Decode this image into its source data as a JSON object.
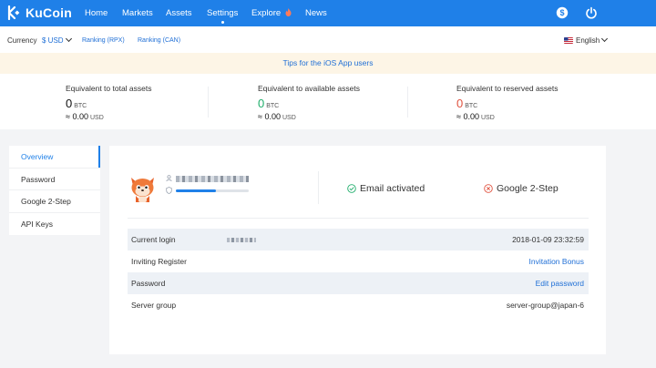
{
  "nav": {
    "brand": "KuCoin",
    "items": [
      {
        "label": "Home"
      },
      {
        "label": "Markets"
      },
      {
        "label": "Assets"
      },
      {
        "label": "Settings"
      },
      {
        "label": "Explore"
      },
      {
        "label": "News"
      }
    ],
    "active": "Settings",
    "icons": [
      "dollar-circle-icon",
      "power-icon"
    ]
  },
  "subbar": {
    "currency_label": "Currency",
    "currency_value": "$ USD",
    "ranking_rpx": "Ranking (RPX)",
    "ranking_can": "Ranking (CAN)",
    "language": "English"
  },
  "tips": {
    "text": "Tips for the iOS App users"
  },
  "assets": [
    {
      "label": "Equivalent to total assets",
      "btc": "0",
      "btc_unit": "BTC",
      "usd": "≈ 0.00",
      "usd_unit": "USD"
    },
    {
      "label": "Equivalent to available assets",
      "btc": "0",
      "btc_unit": "BTC",
      "usd": "≈ 0.00",
      "usd_unit": "USD"
    },
    {
      "label": "Equivalent to reserved assets",
      "btc": "0",
      "btc_unit": "BTC",
      "usd": "≈ 0.00",
      "usd_unit": "USD"
    }
  ],
  "sidebar": {
    "items": [
      {
        "label": "Overview"
      },
      {
        "label": "Password"
      },
      {
        "label": "Google 2-Step"
      },
      {
        "label": "API Keys"
      }
    ],
    "active": "Overview"
  },
  "profile": {
    "security_level": 0.55,
    "email_status": "Email activated",
    "google_status": "Google 2-Step"
  },
  "info": {
    "current_login_label": "Current login",
    "current_login_time": "2018-01-09 23:32:59",
    "inviting_label": "Inviting Register",
    "inviting_link": "Invitation Bonus",
    "password_label": "Password",
    "password_link": "Edit password",
    "server_label": "Server group",
    "server_value": "server-group@japan-6"
  },
  "colors": {
    "brand": "#1f80e8",
    "positive": "#1fae6b",
    "negative": "#e0523f"
  }
}
